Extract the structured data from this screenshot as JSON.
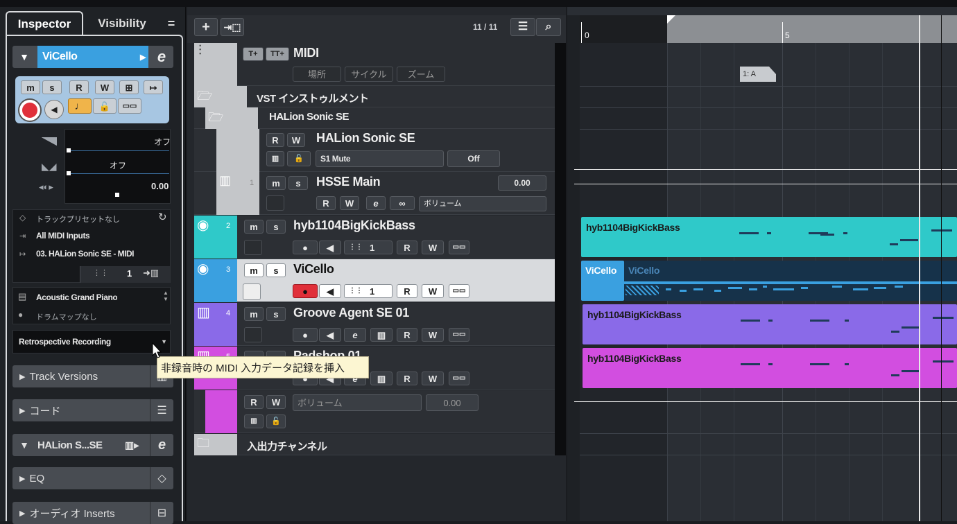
{
  "inspector": {
    "tabs": [
      "Inspector",
      "Visibility"
    ],
    "menu_glyph": "=",
    "track_name": "ViCello",
    "buttons": {
      "m": "m",
      "s": "s",
      "r": "R",
      "w": "W"
    },
    "vol_label": "オフ",
    "pan_label": "オフ",
    "delay_value": "0.00",
    "preset_none": "トラックプリセットなし",
    "midi_input": "All MIDI Inputs",
    "midi_output": "03. HALion Sonic SE - MIDI",
    "channel": "1",
    "program": "Acoustic Grand Piano",
    "drum_map": "ドラムマップなし",
    "retro": "Retrospective Recording",
    "sections": {
      "track_versions": "Track Versions",
      "chord": "コード",
      "halion": "HALion S...SE",
      "eq": "EQ",
      "audio_inserts": "オーディオ Inserts"
    },
    "tooltip": "非録音時の MIDI 入力データ記録を挿入"
  },
  "tracklist": {
    "counter": "11 / 11",
    "midi": {
      "name": "MIDI",
      "b1": "T+",
      "b2": "TT+",
      "loc": "場所",
      "cyc": "サイクル",
      "zoom": "ズーム"
    },
    "vst_folder": "VST インストゥルメント",
    "halion_folder": "HALion Sonic SE",
    "halion_track": {
      "name": "HALion Sonic SE",
      "param": "S1 Mute",
      "value": "Off"
    },
    "hsse": {
      "num": "1",
      "name": "HSSE Main",
      "value": "0.00",
      "param": "ボリューム"
    },
    "tracks": [
      {
        "num": "2",
        "name": "hyb1104BigKickBass",
        "ch": "1"
      },
      {
        "num": "3",
        "name": "ViCello",
        "ch": "1"
      },
      {
        "num": "4",
        "name": "Groove Agent SE 01"
      },
      {
        "num": "5",
        "name": "Padshop 01"
      }
    ],
    "pad_sub": {
      "param": "ボリューム",
      "value": "0.00"
    },
    "io_folder": "入出力チャンネル"
  },
  "arranger": {
    "ruler": [
      "0",
      "5"
    ],
    "marker": "1: A",
    "events": [
      {
        "name": "hyb1104BigKickBass",
        "color": "#2fc9c9"
      },
      {
        "name": "ViCello",
        "name2": "ViCello",
        "color": "#3aa0e0"
      },
      {
        "name": "hyb1104BigKickBass",
        "color": "#8a6ae8"
      },
      {
        "name": "hyb1104BigKickBass",
        "color": "#d24ee0"
      }
    ]
  },
  "colors": {
    "cyan": "#2fc9c9",
    "blue": "#3aa0e0",
    "purple": "#8a6ae8",
    "magenta": "#d24ee0",
    "record": "#e0303a"
  }
}
